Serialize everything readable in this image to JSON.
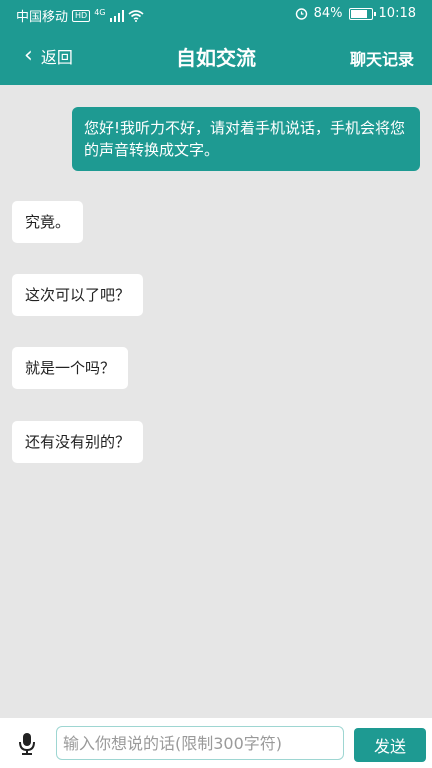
{
  "status_bar": {
    "carrier": "中国移动",
    "hd_badge": "HD",
    "network": "4G",
    "battery_text": "84%",
    "battery_level": 0.84,
    "time": "10:18"
  },
  "header": {
    "back_label": "返回",
    "title": "自如交流",
    "history_label": "聊天记录"
  },
  "messages": {
    "self": [
      {
        "text": "您好!我听力不好，请对着手机说话，手机会将您的声音转换成文字。"
      }
    ],
    "others": [
      {
        "text": "究竟。"
      },
      {
        "text": "这次可以了吧？"
      },
      {
        "text": "就是一个吗？"
      },
      {
        "text": "还有没有别的？"
      }
    ]
  },
  "input_bar": {
    "placeholder": "输入你想说的话(限制300字符)",
    "value": "",
    "send_label": "发送"
  },
  "colors": {
    "accent": "#1e9a92",
    "background": "#e6e6e6"
  },
  "icons": [
    "back-chevron-icon",
    "signal-icon",
    "wifi-icon",
    "alarm-icon",
    "battery-icon",
    "microphone-icon"
  ]
}
